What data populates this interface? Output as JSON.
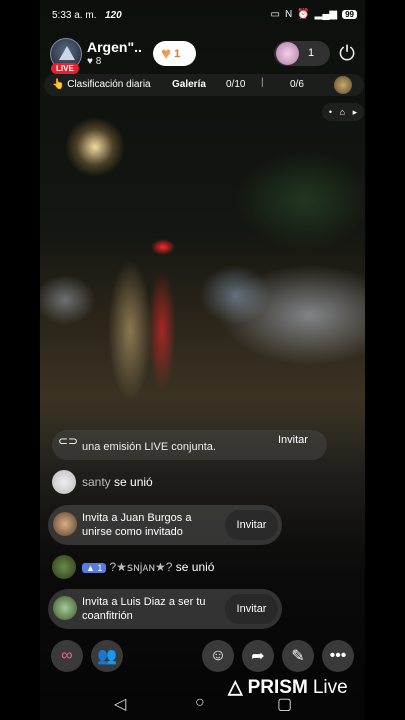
{
  "status_bar": {
    "time": "5:33 a. m.",
    "speed": "120",
    "battery": "99"
  },
  "host": {
    "name": "Argen\"..",
    "badge": "LIVE",
    "likes": "8"
  },
  "heart": {
    "count": "1"
  },
  "viewers": {
    "count": "1"
  },
  "info_row": {
    "ranking": "Clasificación diaria",
    "gallery": "Galería",
    "gallery_count": "0/10",
    "gallery_count2": "0/6"
  },
  "chat": {
    "prev_message": "una emisión LIVE conjunta.",
    "prev_button": "Invitar",
    "join1": {
      "user": "santy",
      "action": "se unió"
    },
    "invite1": {
      "text": "Invita a Juan Burgos a unirse como invitado",
      "button": "Invitar"
    },
    "join2": {
      "level": "1",
      "user": "?★ꜱɴjᴀɴ★?",
      "action": "se unió"
    },
    "invite2": {
      "text": "Invita a Luis Diaz a ser tu coanfitrión",
      "button": "Invitar"
    }
  },
  "watermark": {
    "brand": "PRISM",
    "suffix": "Live"
  },
  "icons": {
    "heart": "heart-icon",
    "power": "power-icon",
    "home": "home-icon"
  }
}
